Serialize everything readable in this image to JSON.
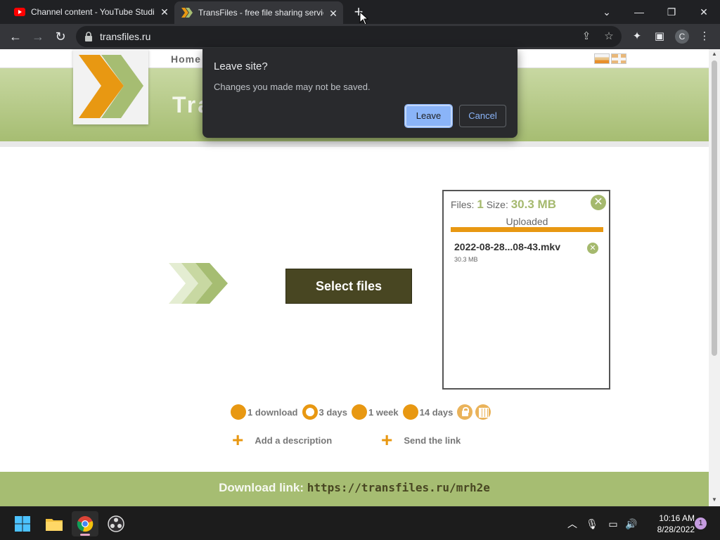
{
  "browser": {
    "tabs": [
      {
        "title": "Channel content - YouTube Studio",
        "favicon": "youtube-icon",
        "active": false
      },
      {
        "title": "TransFiles - free file sharing service",
        "favicon": "transfiles-icon",
        "active": true
      }
    ],
    "url": "transfiles.ru",
    "profile_initial": "C"
  },
  "site": {
    "nav_home": "Home",
    "banner_title": "Tra",
    "select_files": "Select files",
    "files_panel": {
      "files_label": "Files:",
      "files_count": "1",
      "size_label": "Size:",
      "size_value": "30.3 MB",
      "status": "Uploaded",
      "progress": 1.0,
      "file_name": "2022-08-28...08-43.mkv",
      "file_size": "30.3 MB"
    },
    "options": [
      {
        "label": "1 download",
        "selected": false
      },
      {
        "label": "3 days",
        "selected": true
      },
      {
        "label": "1 week",
        "selected": false
      },
      {
        "label": "14 days",
        "selected": false
      }
    ],
    "add_description": "Add a description",
    "send_link": "Send the link",
    "download_label": "Download link:",
    "download_url": "https://transfiles.ru/mrh2e"
  },
  "dialog": {
    "title": "Leave site?",
    "message": "Changes you made may not be saved.",
    "leave": "Leave",
    "cancel": "Cancel"
  },
  "taskbar": {
    "time": "10:16 AM",
    "date": "8/28/2022",
    "notification_count": "1"
  },
  "colors": {
    "accent_green": "#a6bd72",
    "accent_orange": "#e89812",
    "button_dark": "#484622",
    "dialog_primary": "#8ab4f8"
  }
}
